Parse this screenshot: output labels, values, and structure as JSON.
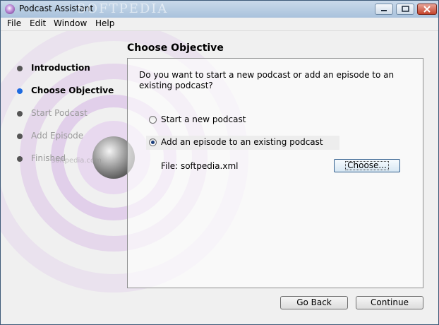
{
  "window": {
    "title": "Podcast Assistant",
    "watermark": "SOFTPEDIA",
    "controls": {
      "minimize": "minimize-icon",
      "maximize": "maximize-icon",
      "close": "close-icon"
    }
  },
  "menu": {
    "items": [
      "File",
      "Edit",
      "Window",
      "Help"
    ]
  },
  "sidebar": {
    "steps": [
      {
        "label": "Introduction",
        "state": "done"
      },
      {
        "label": "Choose Objective",
        "state": "active"
      },
      {
        "label": "Start Podcast",
        "state": "pending"
      },
      {
        "label": "Add Episode",
        "state": "pending"
      },
      {
        "label": "Finished",
        "state": "pending"
      }
    ],
    "watermark": "softpedia.com"
  },
  "main": {
    "heading": "Choose Objective",
    "question": "Do you want to start a new podcast or add an episode to an existing podcast?",
    "options": [
      {
        "label": "Start a new podcast",
        "selected": false
      },
      {
        "label": "Add an episode to an existing podcast",
        "selected": true
      }
    ],
    "file_label": "File: softpedia.xml",
    "choose_button": "Choose..."
  },
  "footer": {
    "back_button": "Go Back",
    "continue_button": "Continue"
  },
  "colors": {
    "accent": "#1e6be0",
    "titlebar": "#b9cfe2",
    "decor": "#c9a6dd"
  }
}
